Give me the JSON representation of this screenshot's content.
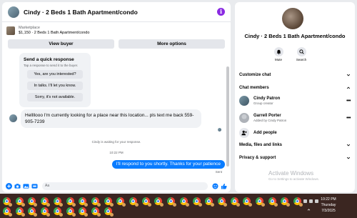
{
  "chat": {
    "title": "Cindy · 2 Beds 1 Bath Apartment/condo",
    "marketplace_label": "Marketplace",
    "listing": "$1,150 · 2 Beds 1 Bath Apartment/condo",
    "view_buyer": "View buyer",
    "more_options": "More options",
    "quick_response": {
      "title": "Send a quick response",
      "subtitle": "Tap a response to send it to the buyer.",
      "options": [
        "Yes, are you interested?",
        "In talks. I'll let you know.",
        "Sorry, it's not available."
      ]
    },
    "incoming_message": "Hellllooo I'm currently looking for a place near this location... pls text me back 559-905-7239",
    "waiting_text": "Cindy is waiting for your response.",
    "timestamp": "10:22 PM",
    "outgoing_message": "I'll respond to you shortly. Thanks for your patience",
    "sent_status": "Sent",
    "composer_placeholder": "Aa"
  },
  "details": {
    "title": "Cindy · 2 Beds 1 Bath Apartment/condo",
    "actions": [
      "Mute",
      "Search"
    ],
    "customize_chat": "Customize chat",
    "chat_members": "Chat members",
    "members": [
      {
        "name": "Cindy Patron",
        "role": "Group creator"
      },
      {
        "name": "Garrell Porter",
        "role": "Added by Cindy Patron"
      }
    ],
    "add_people": "Add people",
    "media_files_links": "Media, files and links",
    "privacy_support": "Privacy & support",
    "watermark_line1": "Activate Windows",
    "watermark_line2": "Go to Settings to activate Windows."
  },
  "taskbar": {
    "time": "10:22 PM",
    "day": "Thursday",
    "date": "7/3/2025"
  },
  "colors": {
    "accent": "#0a7cff",
    "taskbar": "#3b2621",
    "info_icon": "#8a2be2"
  }
}
